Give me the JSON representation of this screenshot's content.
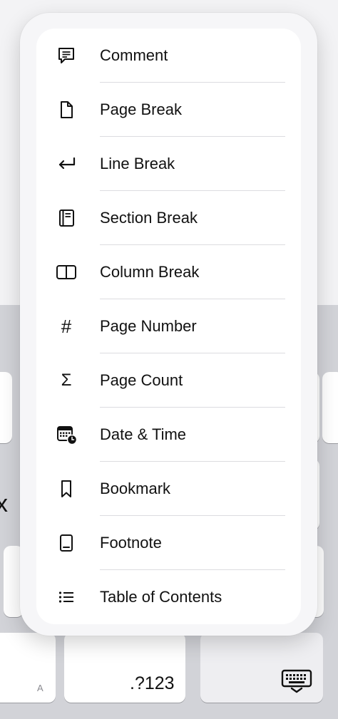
{
  "insert_menu": {
    "items": [
      {
        "label": "Comment",
        "icon": "comment-icon"
      },
      {
        "label": "Page Break",
        "icon": "page-break-icon"
      },
      {
        "label": "Line Break",
        "icon": "line-break-icon"
      },
      {
        "label": "Section Break",
        "icon": "section-break-icon"
      },
      {
        "label": "Column Break",
        "icon": "column-break-icon"
      },
      {
        "label": "Page Number",
        "icon": "hash-icon",
        "glyph": "#"
      },
      {
        "label": "Page Count",
        "icon": "sigma-icon",
        "glyph": "Σ"
      },
      {
        "label": "Date & Time",
        "icon": "calendar-clock-icon"
      },
      {
        "label": "Bookmark",
        "icon": "bookmark-icon"
      },
      {
        "label": "Footnote",
        "icon": "footnote-icon"
      },
      {
        "label": "Table of Contents",
        "icon": "list-icon"
      }
    ]
  },
  "keyboard": {
    "partial_key_letter": "x",
    "key_hint_letter": "A",
    "numbers_key_label": ".?123",
    "dismiss_key_icon": "keyboard-dismiss-icon"
  },
  "colors": {
    "text": "#111111",
    "separator": "#dcdce0",
    "card": "#ffffff",
    "keyboard_background": "#d2d3d8"
  }
}
